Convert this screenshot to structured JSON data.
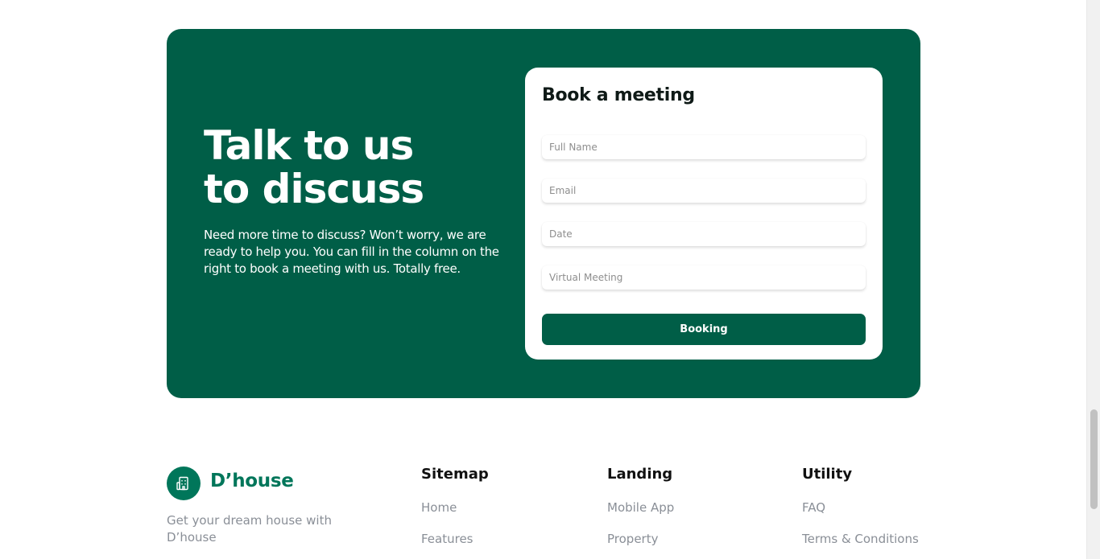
{
  "cta": {
    "title_line1": "Talk to us",
    "title_line2": "to discuss",
    "description": "Need more time to discuss? Won’t worry, we are ready to help you. You can fill in the column on the right to book a meeting with us. Totally free."
  },
  "form": {
    "title": "Book a meeting",
    "full_name_placeholder": "Full Name",
    "email_placeholder": "Email",
    "date_placeholder": "Date",
    "virtual_meeting_placeholder": "Virtual Meeting",
    "submit_label": "Booking"
  },
  "footer": {
    "brand": "D’house",
    "tagline": "Get your dream house with D’house",
    "columns": [
      {
        "title": "Sitemap",
        "links": [
          "Home",
          "Features"
        ]
      },
      {
        "title": "Landing",
        "links": [
          "Mobile App",
          "Property"
        ]
      },
      {
        "title": "Utility",
        "links": [
          "FAQ",
          "Terms & Conditions"
        ]
      }
    ]
  },
  "icons": {
    "logo": "building-icon"
  },
  "colors": {
    "primary_green": "#005e47",
    "brand_green": "#00765a",
    "muted_text": "#8a8f97"
  }
}
